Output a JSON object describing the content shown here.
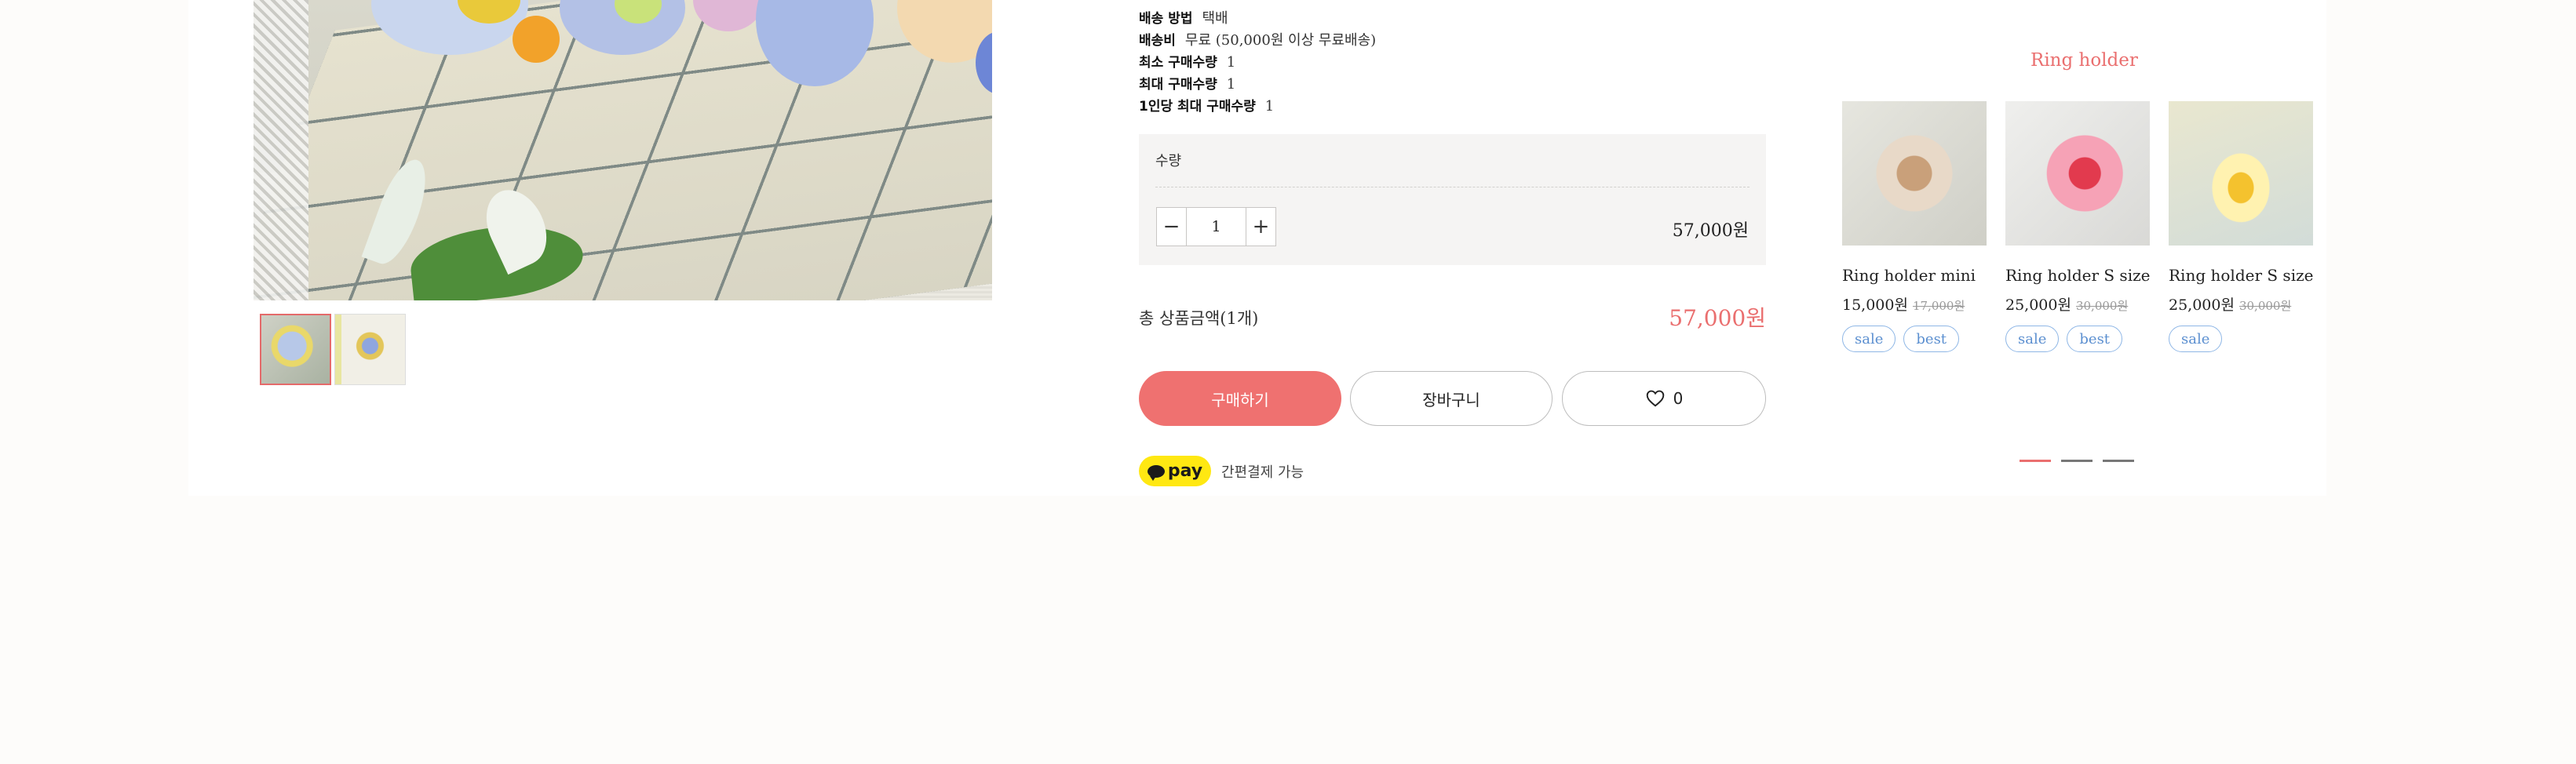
{
  "details": [
    {
      "label": "배송 방법",
      "value": "택배"
    },
    {
      "label": "배송비",
      "value": "무료 (50,000원 이상 무료배송)"
    },
    {
      "label": "최소 구매수량",
      "value": "1"
    },
    {
      "label": "최대 구매수량",
      "value": "1"
    },
    {
      "label": "1인당 최대 구매수량",
      "value": "1"
    }
  ],
  "quantity": {
    "title": "수량",
    "value": "1",
    "minus": "−",
    "plus": "+",
    "line_price": "57,000원"
  },
  "total": {
    "label": "총 상품금액(1개)",
    "price": "57,000원"
  },
  "buttons": {
    "buy": "구매하기",
    "cart": "장바구니",
    "like_count": "0"
  },
  "pay": {
    "badge": "pay",
    "text": "간편결제 가능"
  },
  "recommended": {
    "title": "Ring holder",
    "items": [
      {
        "name": "Ring holder mini",
        "price": "15,000원",
        "old_price": "17,000원",
        "badges": [
          "sale",
          "best"
        ]
      },
      {
        "name": "Ring holder S size",
        "price": "25,000원",
        "old_price": "30,000원",
        "badges": [
          "sale",
          "best"
        ]
      },
      {
        "name": "Ring holder S size",
        "price": "25,000원",
        "old_price": "30,000원",
        "badges": [
          "sale"
        ]
      }
    ],
    "pages": 3,
    "active_page": 1
  },
  "colors": {
    "accent": "#ea6f6f",
    "badge": "#8fb7e6",
    "pay": "#ffe812"
  }
}
